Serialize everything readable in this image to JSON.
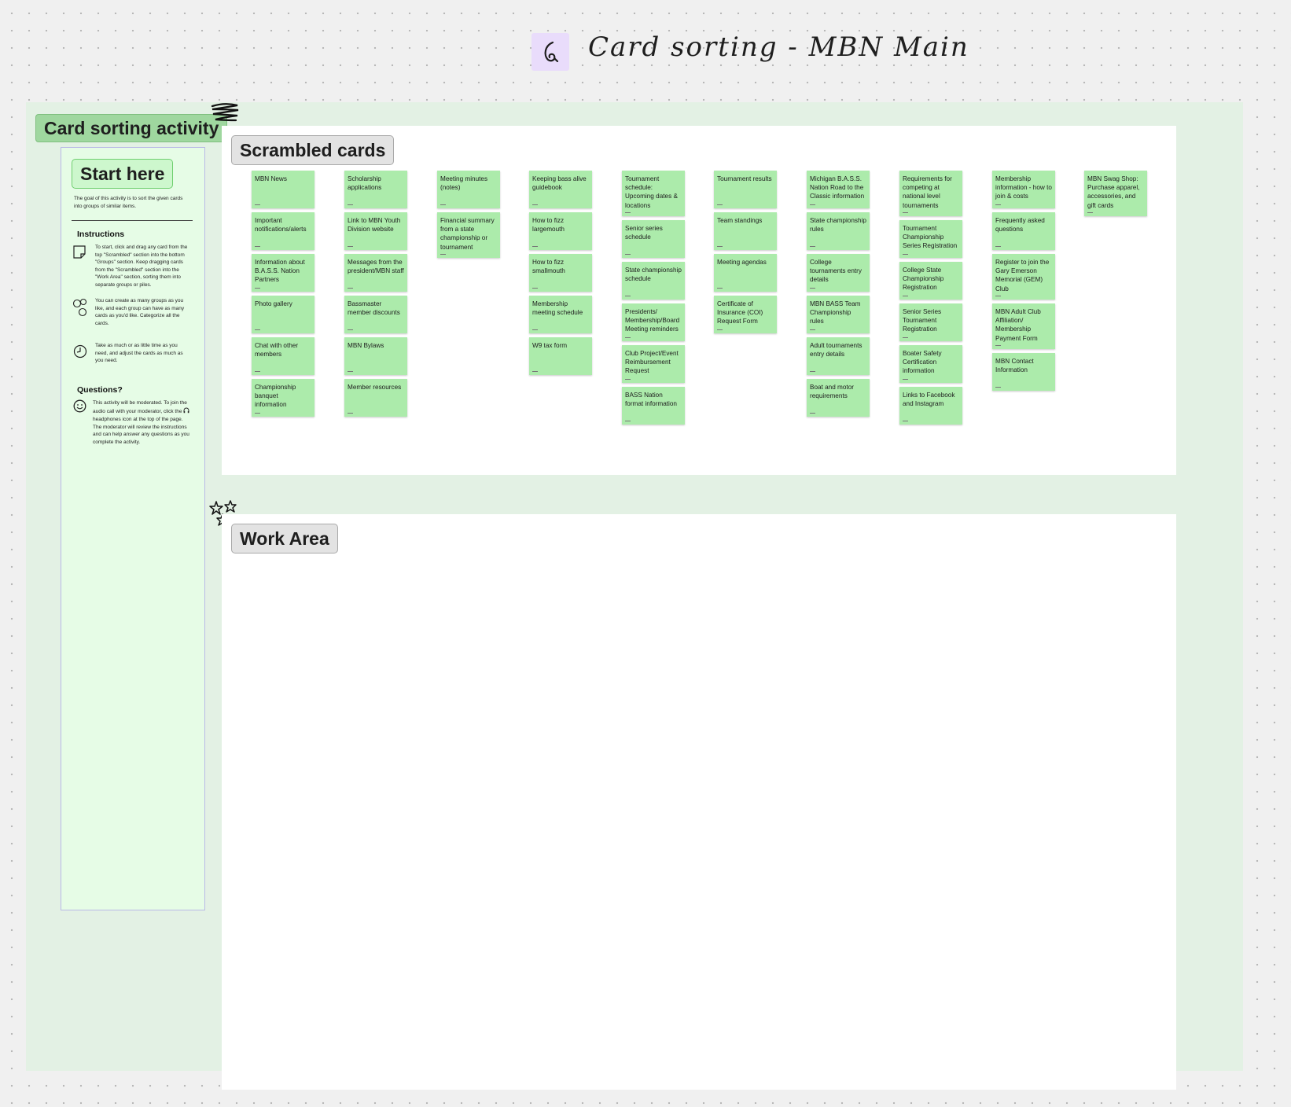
{
  "board": {
    "title": "Card sorting - MBN Main"
  },
  "section": {
    "label": "Card sorting activity"
  },
  "info_panel": {
    "start_label": "Start here",
    "goal": "The goal of this activity is to sort the given cards into groups of similar items.",
    "instructions_heading": "Instructions",
    "instructions": [
      {
        "icon": "sticky-note-icon",
        "text": "To start, click and drag any card from the top \"Scrambled\" section into the bottom \"Groups\" section. Keep dragging cards from the \"Scrambled\" section into the \"Work Area\" section, sorting them into separate groups or piles."
      },
      {
        "icon": "shapes-icon",
        "text": "You can create as many groups as you like, and each group can have as many cards as you'd like. Categorize all the cards."
      },
      {
        "icon": "clock-icon",
        "text": "Take as much or as little time as you need, and adjust the cards as much as you need."
      }
    ],
    "questions_heading": "Questions?",
    "questions_text_before": "This activity will be moderated. To join the audio call with your moderator, click the",
    "questions_text_after": "headphones icon at the top of the page. The moderator will review the instructions and can help answer any questions as you complete the activity."
  },
  "scrambled": {
    "label": "Scrambled cards"
  },
  "work_area": {
    "label": "Work Area"
  },
  "columns": [
    [
      "MBN News",
      "Important notifications/alerts",
      "Information about B.A.S.S. Nation Partners",
      "Photo gallery",
      "Chat with other members",
      "Championship banquet information"
    ],
    [
      "Scholarship applications",
      "Link to MBN Youth Division website",
      "Messages from the president/MBN staff",
      "Bassmaster member discounts",
      "MBN Bylaws",
      "Member resources"
    ],
    [
      "Meeting minutes (notes)",
      "Financial summary from a state championship or tournament"
    ],
    [
      "Keeping bass alive guidebook",
      "How to fizz largemouth",
      "How to fizz smallmouth",
      "Membership meeting schedule",
      "W9 tax form"
    ],
    [
      "Tournament schedule: Upcoming dates & locations",
      "Senior series schedule",
      "State championship schedule",
      "Presidents/ Membership/Board Meeting reminders",
      "Club Project/Event Reimbursement Request",
      "BASS Nation format information"
    ],
    [
      "Tournament results",
      "Team standings",
      "Meeting agendas",
      "Certificate of Insurance (COI) Request Form"
    ],
    [
      "Michigan B.A.S.S. Nation Road to the Classic information",
      "State championship rules",
      "College tournaments entry details",
      "MBN BASS Team Championship rules",
      "Adult tournaments entry details",
      "Boat and motor requirements"
    ],
    [
      "Requirements for competing at national level tournaments",
      "Tournament Championship Series Registration",
      "College State Championship Registration",
      "Senior Series Tournament Registration",
      "Boater Safety Certification information",
      "Links to Facebook and Instagram"
    ],
    [
      "Membership information - how to join & costs",
      "Frequently asked questions",
      "Register to join the Gary Emerson Memorial (GEM) Club",
      "MBN Adult Club Affiliation/ Membership Payment Form",
      "MBN Contact Information"
    ],
    [
      "MBN Swag Shop: Purchase apparel, accessories, and gift cards"
    ]
  ]
}
